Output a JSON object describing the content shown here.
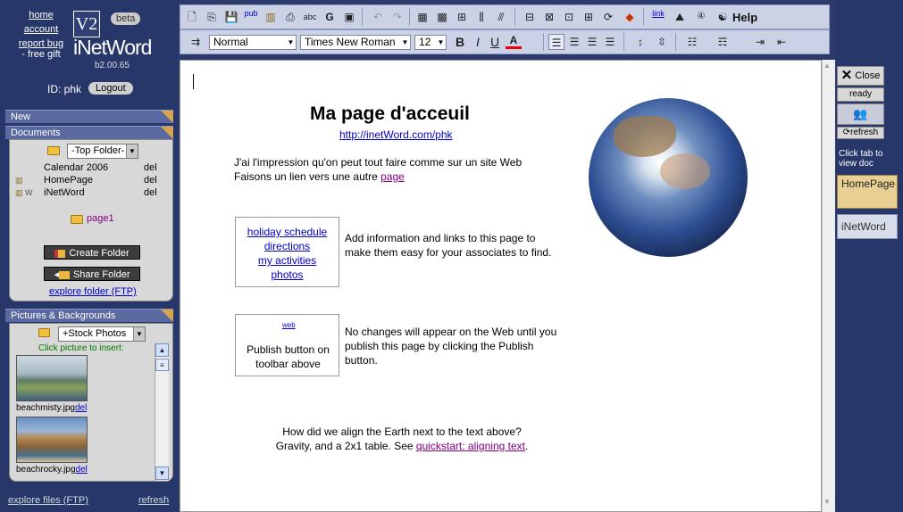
{
  "left": {
    "links": {
      "home": "home",
      "account": "account",
      "report": "report bug",
      "gift": "- free gift"
    },
    "logo": {
      "mark": "V2",
      "beta": "beta",
      "name": "iNetWord",
      "version": "b2.00.65"
    },
    "id_label": "ID: phk",
    "logout": "Logout",
    "new_header": "New",
    "documents_header": "Documents",
    "folder_select": "-Top Folder-",
    "docs": [
      {
        "name": "Calendar 2006",
        "del": "del"
      },
      {
        "name": "HomePage",
        "del": "del"
      },
      {
        "name": "iNetWord",
        "del": "del"
      }
    ],
    "subfolder": "page1",
    "create_folder": "Create Folder",
    "share_folder": "Share Folder",
    "explore_folder": "explore folder (FTP)",
    "pictures_header": "Pictures & Backgrounds",
    "stock_select": "+Stock Photos",
    "insert_hint": "Click picture to insert:",
    "pictures": [
      {
        "name": "beachmisty.jpg",
        "del": "del"
      },
      {
        "name": "beachrocky.jpg",
        "del": "del"
      }
    ],
    "explore_files": "explore files (FTP)",
    "refresh": "refresh"
  },
  "toolbar": {
    "help": "Help",
    "style": "Normal",
    "font": "Times New Roman",
    "size": "12",
    "pub": "pub",
    "link": "link"
  },
  "document": {
    "title": "Ma page d'acceuil",
    "url": "http://inetWord.com/phk",
    "intro_line1": "J'ai l'impression qu'on peut tout faire comme sur un site Web",
    "intro_line2": "Faisons un lien vers une autre",
    "intro_link": "page",
    "links": [
      "holiday schedule",
      "directions",
      "my activities",
      "photos"
    ],
    "links_desc": "Add information and links to this page to make them easy for your associates to find.",
    "publish_icon_label": "web",
    "publish_box": "Publish button on toolbar above",
    "publish_desc": "No changes will appear on the Web until you publish this page by clicking the Publish button.",
    "footer_line1": "How did we align the Earth next to the text above?",
    "footer_line2": "Gravity, and a 2x1 table. See",
    "footer_link": "quickstart: aligning text",
    "footer_end": "."
  },
  "right": {
    "close": "Close",
    "ready": "ready",
    "refresh": "refresh",
    "hint": "Click tab to view doc",
    "tabs": [
      "HomePage",
      "iNetWord"
    ]
  }
}
